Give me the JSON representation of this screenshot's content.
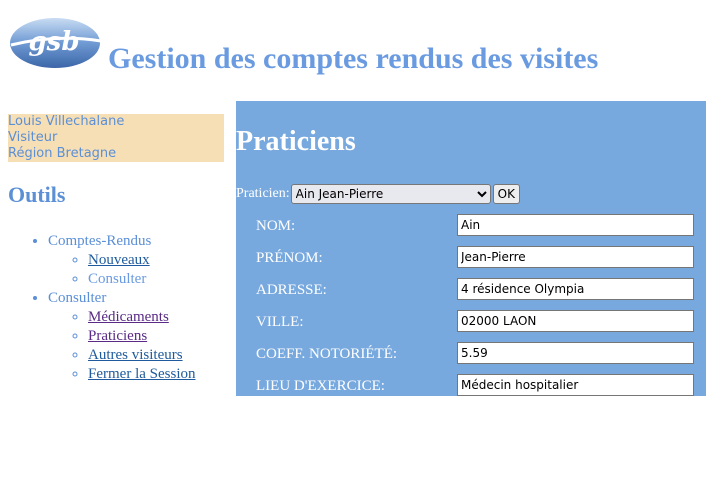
{
  "header": {
    "logo_text": "gsb",
    "title": "Gestion des comptes rendus des visites"
  },
  "user": {
    "name": "Louis Villechalane",
    "role": "Visiteur",
    "region": "Région Bretagne"
  },
  "sidebar": {
    "heading": "Outils",
    "groups": [
      {
        "label": "Comptes-Rendus",
        "items": [
          {
            "label": "Nouveaux"
          },
          {
            "label": "Consulter"
          }
        ]
      },
      {
        "label": "Consulter",
        "items": [
          {
            "label": "Médicaments"
          },
          {
            "label": "Praticiens"
          },
          {
            "label": "Autres visiteurs"
          },
          {
            "label": "Fermer la Session"
          }
        ]
      }
    ]
  },
  "main": {
    "title": "Praticiens",
    "selector": {
      "label": "Praticien:",
      "selected": "Ain Jean-Pierre",
      "button_label": "OK"
    },
    "fields": [
      {
        "label": "NOM:",
        "value": "Ain"
      },
      {
        "label": "PRÉNOM:",
        "value": "Jean-Pierre"
      },
      {
        "label": "ADRESSE:",
        "value": "4 résidence Olympia"
      },
      {
        "label": "VILLE:",
        "value": "02000 LAON"
      },
      {
        "label": "COEFF. NOTORIÉTÉ:",
        "value": "5.59"
      },
      {
        "label": "LIEU D'EXERCICE:",
        "value": "Médecin hospitalier"
      }
    ]
  },
  "colors": {
    "accent": "#6a9be0",
    "panel": "#78a9de",
    "user_box": "#f7dfb5"
  }
}
